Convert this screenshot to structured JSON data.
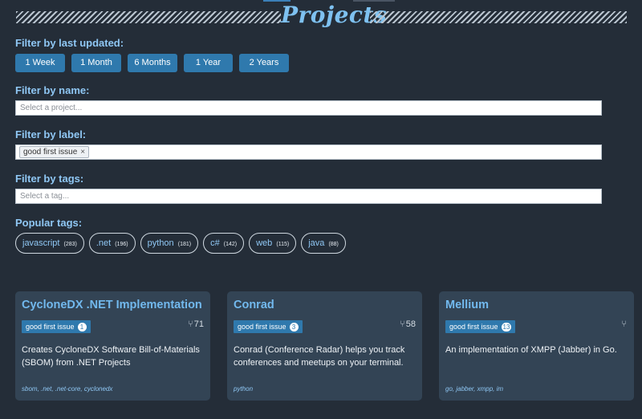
{
  "header": {
    "title": "Projects"
  },
  "filters": {
    "last_updated_label": "Filter by last updated:",
    "periods": [
      "1 Week",
      "1 Month",
      "6 Months",
      "1 Year",
      "2 Years"
    ],
    "name_label": "Filter by name:",
    "name_placeholder": "Select a project...",
    "label_label": "Filter by label:",
    "label_chip": "good first issue",
    "label_chip_remove": "×",
    "tags_label": "Filter by tags:",
    "tags_placeholder": "Select a tag..."
  },
  "popular_tags": {
    "label": "Popular tags:",
    "items": [
      {
        "name": "javascript",
        "count": "(283)"
      },
      {
        "name": ".net",
        "count": "(196)"
      },
      {
        "name": "python",
        "count": "(181)"
      },
      {
        "name": "c#",
        "count": "(142)"
      },
      {
        "name": "web",
        "count": "(115)"
      },
      {
        "name": "java",
        "count": "(88)"
      }
    ]
  },
  "projects": [
    {
      "title": "CycloneDX .NET Implementation",
      "badge": "good first issue",
      "badge_count": "1",
      "forks": "71",
      "description": "Creates CycloneDX Software Bill-of-Materials (SBOM) from .NET Projects",
      "tags": "sbom, .net, .net-core, cyclonedx"
    },
    {
      "title": "Conrad",
      "badge": "good first issue",
      "badge_count": "3",
      "forks": "58",
      "description": "Conrad (Conference Radar) helps you track conferences and meetups on your terminal.",
      "tags": "python"
    },
    {
      "title": "Mellium",
      "badge": "good first issue",
      "badge_count": "13",
      "forks": "",
      "description": "An implementation of XMPP (Jabber) in Go.",
      "tags": "go, jabber, xmpp, im"
    }
  ],
  "icons": {
    "fork": "fork-icon",
    "remove": "close-icon"
  },
  "colors": {
    "background": "#242d38",
    "card": "#334455",
    "accent": "#2f79ad",
    "link": "#72b9ee"
  }
}
